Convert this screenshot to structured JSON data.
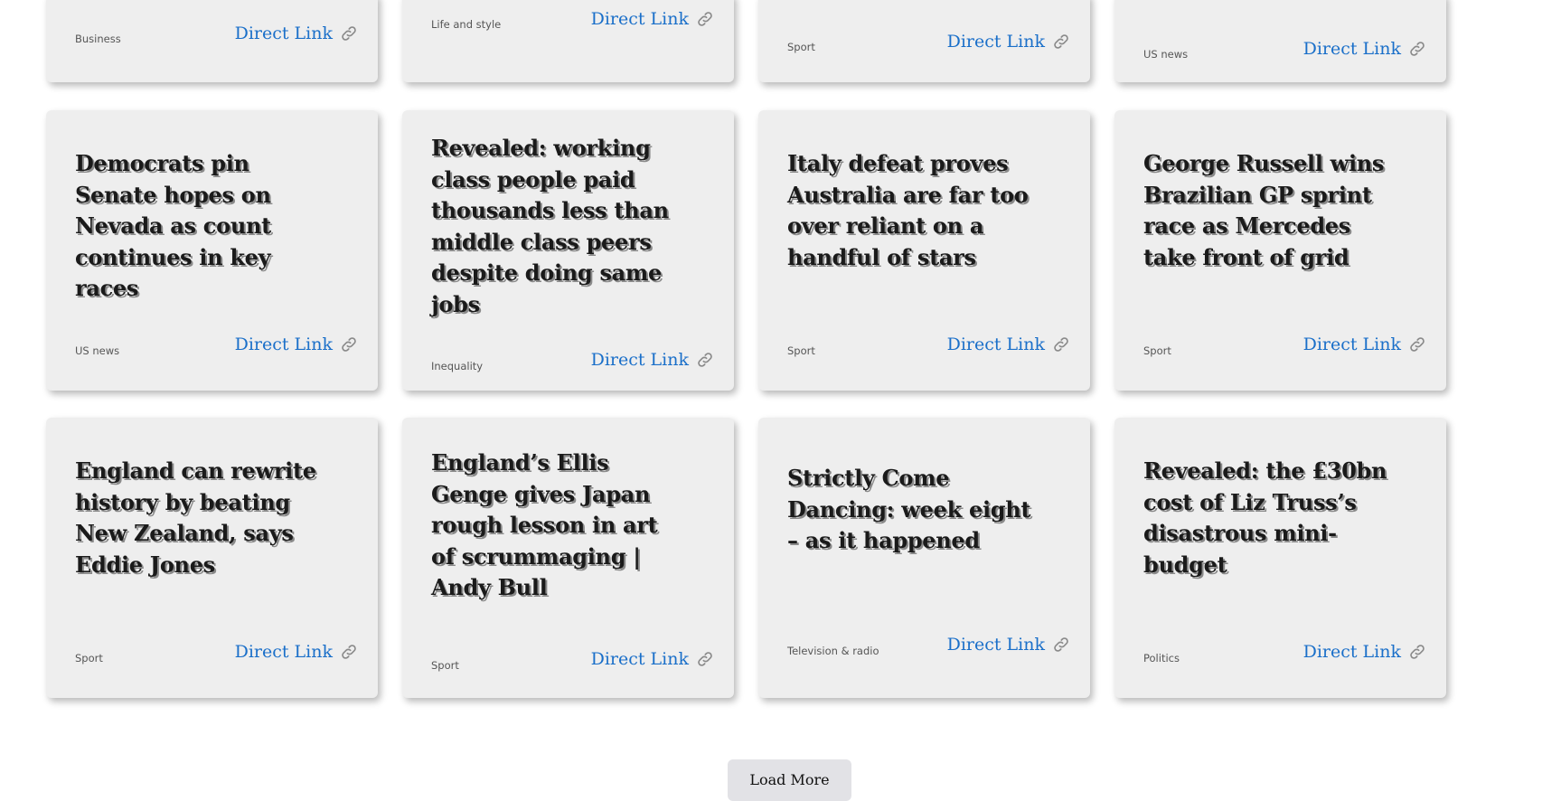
{
  "link_label": "Direct Link",
  "link_icon": "link-chain-icon",
  "accent_color": "#1a6fc9",
  "top_row": [
    {
      "category": "Business"
    },
    {
      "category": "Life and style"
    },
    {
      "category": "Sport"
    },
    {
      "category": "US news"
    }
  ],
  "articles": [
    {
      "title": "Democrats pin Senate hopes on Nevada as count continues in key races",
      "category": "US news"
    },
    {
      "title": "Revealed: working class people paid thousands less than middle class peers despite doing same jobs",
      "category": "Inequality"
    },
    {
      "title": "Italy defeat proves Australia are far too over reliant on a handful of stars",
      "category": "Sport"
    },
    {
      "title": "George Russell wins Brazilian GP sprint race as Mercedes take front of grid",
      "category": "Sport"
    },
    {
      "title": "England can rewrite history by beating New Zealand, says Eddie Jones",
      "category": "Sport"
    },
    {
      "title": "England’s Ellis Genge gives Japan rough lesson in art of scrummaging | Andy Bull",
      "category": "Sport"
    },
    {
      "title": "Strictly Come Dancing: week eight – as it happened",
      "category": "Television & radio"
    },
    {
      "title": "Revealed: the £30bn cost of Liz Truss’s disastrous mini-budget",
      "category": "Politics"
    }
  ],
  "load_more_label": "Load More"
}
